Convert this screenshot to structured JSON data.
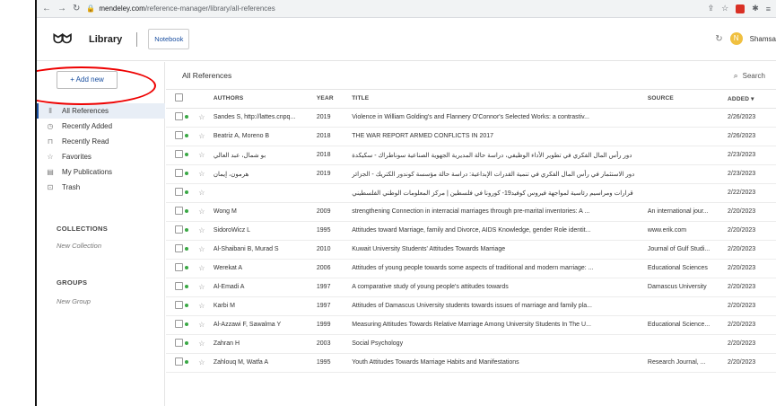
{
  "browser": {
    "url_host": "mendeley.com",
    "url_path": "/reference-manager/library/all-references"
  },
  "app": {
    "title": "Library",
    "notebook_tab": "Notebook",
    "user_initial": "N",
    "user_name": "Shamsa"
  },
  "sidebar": {
    "add_new": "+ Add new",
    "items": [
      {
        "label": "All References",
        "icon": "library-icon"
      },
      {
        "label": "Recently Added",
        "icon": "clock-icon"
      },
      {
        "label": "Recently Read",
        "icon": "bookmark-icon"
      },
      {
        "label": "Favorites",
        "icon": "star-icon"
      },
      {
        "label": "My Publications",
        "icon": "publication-icon"
      },
      {
        "label": "Trash",
        "icon": "trash-icon"
      }
    ],
    "collections_title": "COLLECTIONS",
    "new_collection": "New Collection",
    "groups_title": "GROUPS",
    "new_group": "New Group"
  },
  "main": {
    "title": "All References",
    "search_label": "Search",
    "columns": {
      "authors": "AUTHORS",
      "year": "YEAR",
      "title": "TITLE",
      "source": "SOURCE",
      "added": "ADDED ▾"
    },
    "rows": [
      {
        "authors": "Sandes S, http://lattes.cnpq...",
        "year": "2019",
        "title": "Violence in William Golding's and Flannery O'Connor's Selected Works: a contrastiv...",
        "source": "",
        "added": "2/26/2023"
      },
      {
        "authors": "Beatriz A, Moreno B",
        "year": "2018",
        "title": "THE WAR REPORT ARMED CONFLICTS IN 2017",
        "source": "",
        "added": "2/26/2023"
      },
      {
        "authors": "بو شمال، عبد العالي",
        "year": "2018",
        "title": "دور رأس المال الفكري في تطوير الأداء الوظيفي، دراسة حالة المديرية الجهوية الصناعية سوناطراك - سكيكدة",
        "source": "",
        "added": "2/23/2023"
      },
      {
        "authors": "هرمون، إيمان",
        "year": "2019",
        "title": "دور الاستثمار في رأس المال الفكري في تنمية القدرات الإبداعية: دراسة حالة مؤسسة كوندور الكتريك - الجزائر",
        "source": "",
        "added": "2/23/2023"
      },
      {
        "authors": "",
        "year": "",
        "title": "قرارات ومراسيم رئاسية لمواجهة فيروس كوفيد19- كورونا في فلسطين | مركز المعلومات الوطني الفلسطيني",
        "source": "",
        "added": "2/22/2023"
      },
      {
        "authors": "Wong M",
        "year": "2009",
        "title": "strengthening Connection in interracial marriages through pre-marital inventories: A ...",
        "source": "An international jour...",
        "added": "2/20/2023"
      },
      {
        "authors": "SidoroWicz L",
        "year": "1995",
        "title": "Attitudes toward Marriage, family and Divorce, AIDS Knowledge, gender Role identit...",
        "source": "www.erik.com",
        "added": "2/20/2023"
      },
      {
        "authors": "Al-Shaibani B, Murad S",
        "year": "2010",
        "title": "Kuwait University Students' Attitudes Towards Marriage",
        "source": "Journal of Gulf Studi...",
        "added": "2/20/2023"
      },
      {
        "authors": "Werekat A",
        "year": "2006",
        "title": "Attitudes of young people towards some aspects of traditional and modern marriage: ...",
        "source": "Educational Sciences",
        "added": "2/20/2023"
      },
      {
        "authors": "Al-Emadi A",
        "year": "1997",
        "title": "A comparative study of young people's attitudes towards",
        "source": "Damascus University",
        "added": "2/20/2023"
      },
      {
        "authors": "Karbi M",
        "year": "1997",
        "title": "Attitudes of Damascus University students towards issues of marriage and family pla...",
        "source": "",
        "added": "2/20/2023"
      },
      {
        "authors": "Al-Azzawi F, Sawalma Y",
        "year": "1999",
        "title": "Measuring Attitudes Towards Relative Marriage Among University Students In The U...",
        "source": "Educational Science...",
        "added": "2/20/2023"
      },
      {
        "authors": "Zahran H",
        "year": "2003",
        "title": "Social Psychology",
        "source": "",
        "added": "2/20/2023"
      },
      {
        "authors": "Zahlouq M, Watfa A",
        "year": "1995",
        "title": "Youth Attitudes Towards Marriage Habits and Manifestations",
        "source": "Research Journal, ...",
        "added": "2/20/2023"
      }
    ]
  }
}
